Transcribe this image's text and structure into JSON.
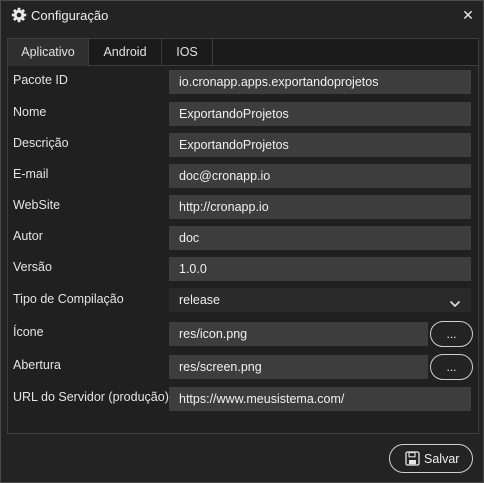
{
  "window": {
    "title": "Configuração",
    "close_glyph": "✕"
  },
  "tabs": [
    {
      "label": "Aplicativo",
      "active": true
    },
    {
      "label": "Android",
      "active": false
    },
    {
      "label": "IOS",
      "active": false
    }
  ],
  "form": {
    "package_id": {
      "label": "Pacote ID",
      "value": "io.cronapp.apps.exportandoprojetos"
    },
    "name": {
      "label": "Nome",
      "value": "ExportandoProjetos"
    },
    "description": {
      "label": "Descrição",
      "value": "ExportandoProjetos"
    },
    "email": {
      "label": "E-mail",
      "value": "doc@cronapp.io"
    },
    "website": {
      "label": "WebSite",
      "value": "http://cronapp.io"
    },
    "author": {
      "label": "Autor",
      "value": "doc"
    },
    "version": {
      "label": "Versão",
      "value": "1.0.0"
    },
    "build_type": {
      "label": "Tipo de Compilação",
      "value": "release"
    },
    "icon": {
      "label": "Ícone",
      "value": "res/icon.png",
      "browse_label": "..."
    },
    "splash": {
      "label": "Abertura",
      "value": "res/screen.png",
      "browse_label": "..."
    },
    "server_url": {
      "label": "URL do Servidor (produção)",
      "value": "https://www.meusistema.com/"
    }
  },
  "footer": {
    "save_label": "Salvar"
  },
  "icons": {
    "title": "gear-icon",
    "close": "close-icon",
    "select": "chevron-down-icon",
    "save": "save-icon"
  }
}
